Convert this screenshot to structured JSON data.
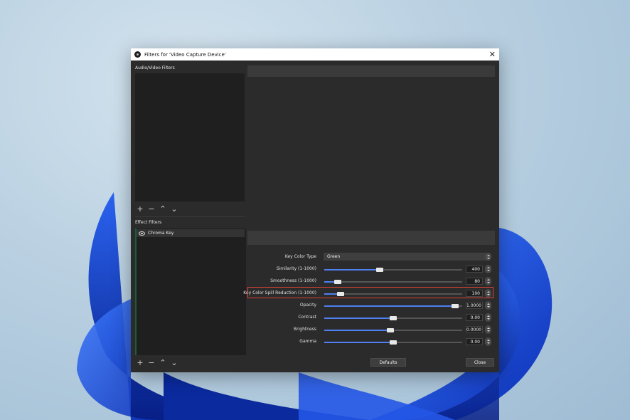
{
  "window": {
    "title": "Filters for 'Video Capture Device'",
    "close_glyph": "✕"
  },
  "audio_video_filters": {
    "label": "Audio/Video Filters"
  },
  "effect_filters": {
    "label": "Effect Filters",
    "items": [
      {
        "name": "Chroma Key",
        "visible": true
      }
    ]
  },
  "toolbar_glyphs": {
    "add": "+",
    "remove": "−",
    "up": "⌃",
    "down": "⌄"
  },
  "properties": {
    "key_color_type": {
      "label": "Key Color Type",
      "value": "Green"
    },
    "sliders": [
      {
        "label": "Similarity (1-1000)",
        "value": "400",
        "fraction": 0.4
      },
      {
        "label": "Smoothness (1-1000)",
        "value": "80",
        "fraction": 0.1
      },
      {
        "label": "Key Color Spill Reduction (1-1000)",
        "value": "100",
        "fraction": 0.12
      },
      {
        "label": "Opacity",
        "value": "1.0000",
        "fraction": 0.95
      },
      {
        "label": "Contrast",
        "value": "0.00",
        "fraction": 0.5
      },
      {
        "label": "Brightness",
        "value": "0.0000",
        "fraction": 0.48
      },
      {
        "label": "Gamma",
        "value": "0.00",
        "fraction": 0.5
      }
    ]
  },
  "buttons": {
    "defaults": "Defaults",
    "close": "Close"
  },
  "colors": {
    "accent": "#4f7ff0",
    "highlight": "#e0433a",
    "window_bg": "#2b2b2b"
  }
}
